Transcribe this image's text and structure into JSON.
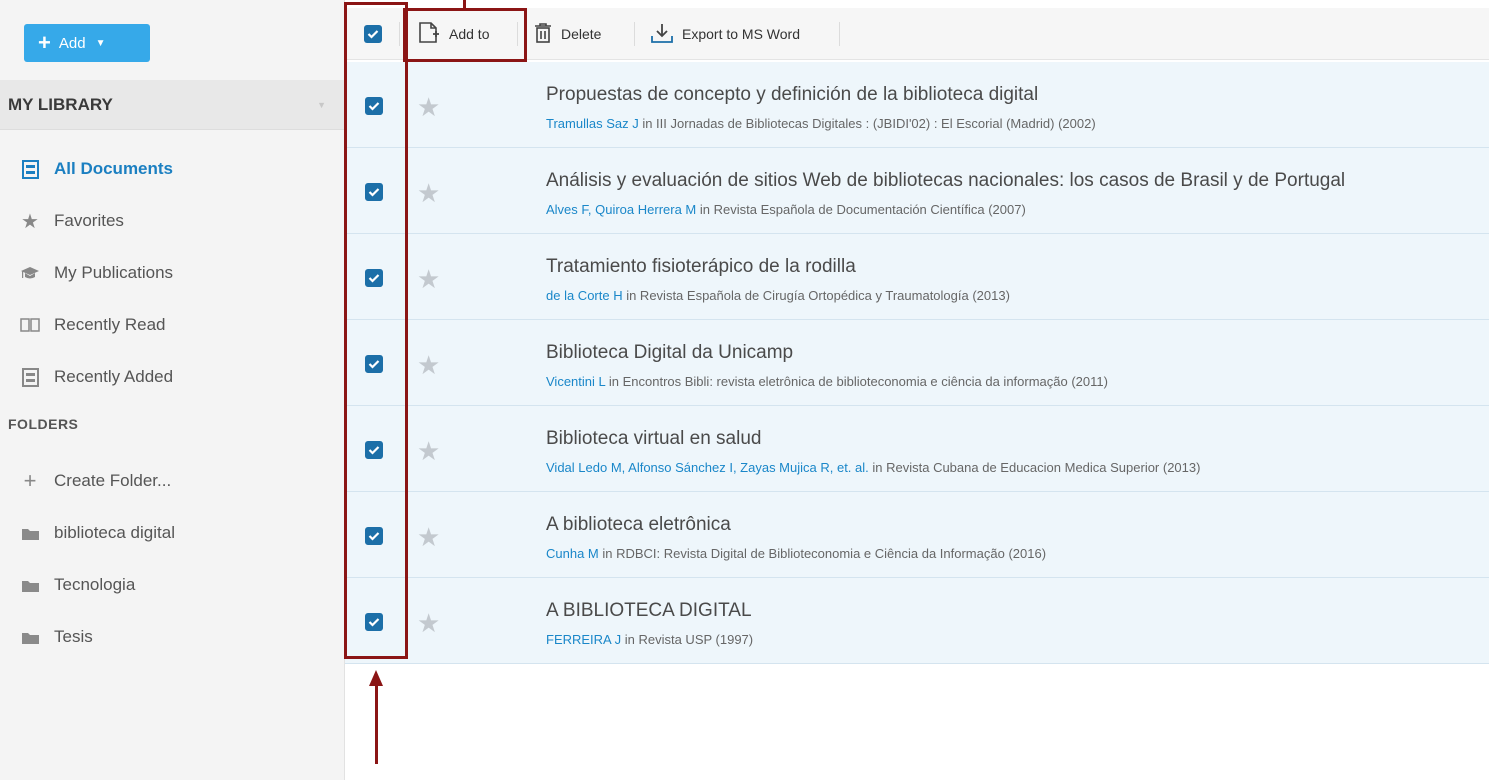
{
  "sidebar": {
    "add_button": {
      "label": "Add"
    },
    "library_header": "MY LIBRARY",
    "nav": [
      {
        "label": "All Documents",
        "icon": "documents-icon"
      },
      {
        "label": "Favorites",
        "icon": "star-icon"
      },
      {
        "label": "My Publications",
        "icon": "graduation-cap-icon"
      },
      {
        "label": "Recently Read",
        "icon": "open-book-icon"
      },
      {
        "label": "Recently Added",
        "icon": "recent-doc-icon"
      }
    ],
    "folders_title": "FOLDERS",
    "folders": [
      {
        "label": "Create Folder...",
        "icon": "plus-icon"
      },
      {
        "label": "biblioteca digital",
        "icon": "folder-icon"
      },
      {
        "label": "Tecnologia",
        "icon": "folder-icon"
      },
      {
        "label": "Tesis",
        "icon": "folder-icon"
      }
    ]
  },
  "toolbar": {
    "add_to": "Add to",
    "delete": "Delete",
    "export": "Export to MS Word"
  },
  "documents": [
    {
      "title": "Propuestas de concepto y definición de la biblioteca digital",
      "authors": "Tramullas Saz J",
      "source": " in III Jornadas de Bibliotecas Digitales : (JBIDI'02) : El Escorial (Madrid) (2002)"
    },
    {
      "title": "Análisis y evaluación de sitios Web de bibliotecas nacionales: los casos de Brasil y de Portugal",
      "authors": "Alves F, Quiroa Herrera M",
      "source": " in Revista Española de Documentación Científica (2007)"
    },
    {
      "title": "Tratamiento fisioterápico de la rodilla",
      "authors": "de la Corte H",
      "source": " in Revista Española de Cirugía Ortopédica y Traumatología (2013)"
    },
    {
      "title": "Biblioteca Digital da Unicamp",
      "authors": "Vicentini L",
      "source": " in Encontros Bibli: revista eletrônica de biblioteconomia e ciência da informação (2011)"
    },
    {
      "title": "Biblioteca virtual en salud",
      "authors": "Vidal Ledo M, Alfonso Sánchez I, Zayas Mujica R, et. al.",
      "source": " in Revista Cubana de Educacion Medica Superior (2013)"
    },
    {
      "title": "A biblioteca eletrônica",
      "authors": "Cunha M",
      "source": " in RDBCI: Revista Digital de Biblioteconomia e Ciência da Informação (2016)"
    },
    {
      "title": "A BIBLIOTECA DIGITAL",
      "authors": "FERREIRA J",
      "source": " in Revista USP (1997)"
    }
  ],
  "colors": {
    "accent": "#36a9e9",
    "link": "#1a87c9",
    "checkbox": "#1c6fa8",
    "annotation": "#8b1515",
    "row_bg": "#eef6fb"
  }
}
